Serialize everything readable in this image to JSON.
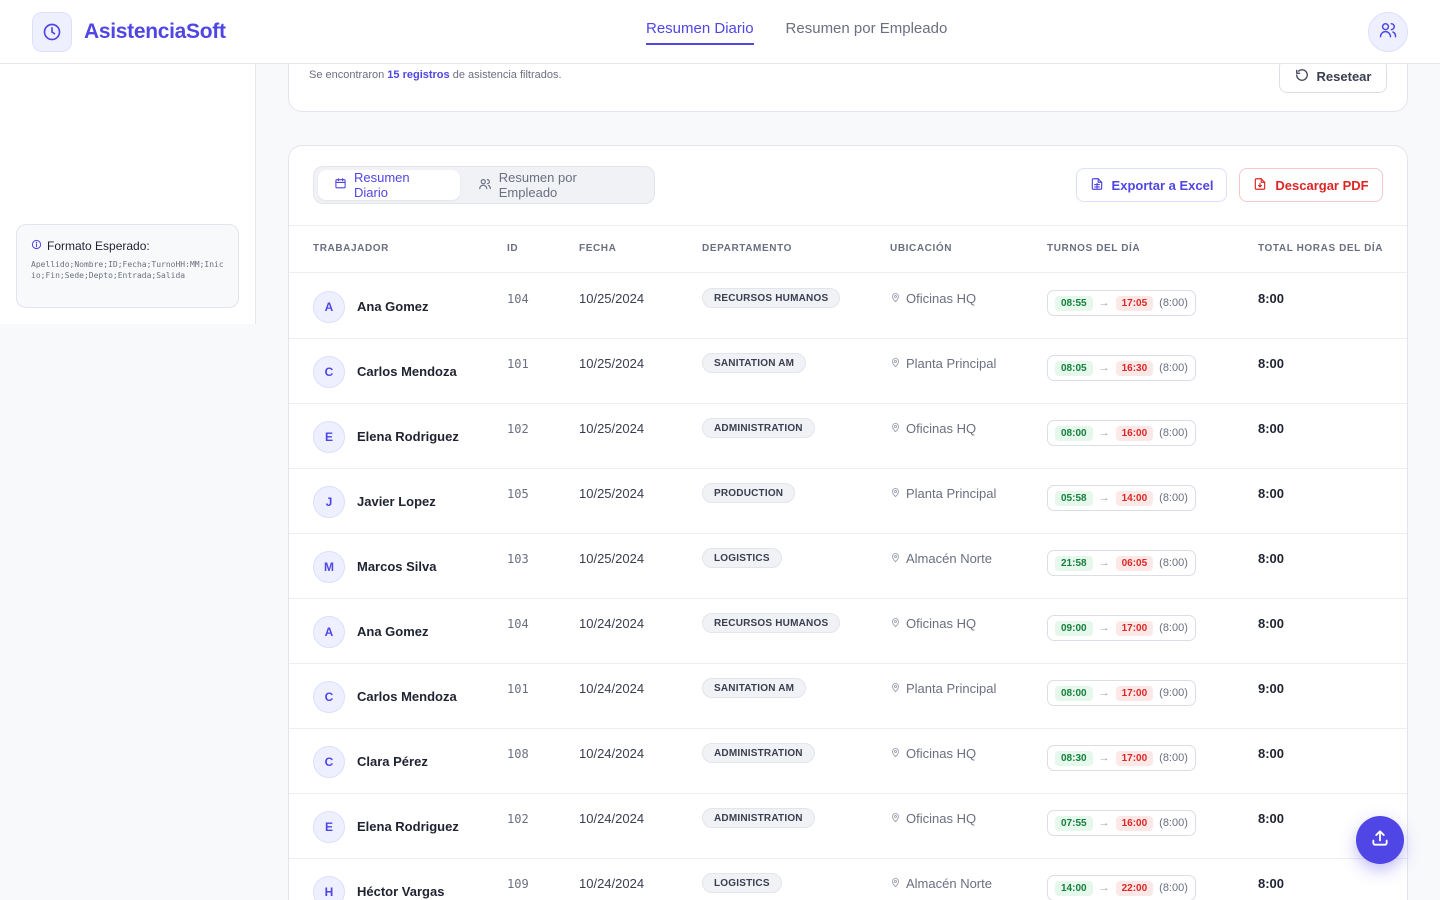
{
  "app": {
    "title": "AsistenciaSoft"
  },
  "nav": {
    "tabs": [
      {
        "label": "Resumen Diario"
      },
      {
        "label": "Resumen por Empleado"
      }
    ]
  },
  "sidebar": {
    "format_title": "Formato Esperado:",
    "format_text": "Apellido;Nombre;ID;Fecha;TurnoHH:MM;Inicio;Fin;Sede;Depto;Entrada;Salida"
  },
  "filter": {
    "info_prefix": "Se encontraron",
    "info_count": "15 registros",
    "info_suffix": "de asistencia filtrados.",
    "reset_label": "Resetear"
  },
  "table_card": {
    "views": [
      {
        "label": "Resumen Diario"
      },
      {
        "label": "Resumen por Empleado"
      }
    ],
    "export_excel_label": "Exportar a Excel",
    "download_pdf_label": "Descargar PDF",
    "columns": [
      "TRABAJADOR",
      "ID",
      "FECHA",
      "DEPARTAMENTO",
      "UBICACIÓN",
      "TURNOS DEL DÍA",
      "TOTAL HORAS DEL DÍA"
    ]
  },
  "rows": [
    {
      "initial": "A",
      "name": "Ana Gomez",
      "id": "104",
      "date": "10/25/2024",
      "dept": "RECURSOS HUMANOS",
      "location": "Oficinas HQ",
      "in": "08:55",
      "out": "17:05",
      "duration": "(8:00)",
      "total": "8:00"
    },
    {
      "initial": "C",
      "name": "Carlos Mendoza",
      "id": "101",
      "date": "10/25/2024",
      "dept": "SANITATION AM",
      "location": "Planta Principal",
      "in": "08:05",
      "out": "16:30",
      "duration": "(8:00)",
      "total": "8:00"
    },
    {
      "initial": "E",
      "name": "Elena Rodriguez",
      "id": "102",
      "date": "10/25/2024",
      "dept": "ADMINISTRATION",
      "location": "Oficinas HQ",
      "in": "08:00",
      "out": "16:00",
      "duration": "(8:00)",
      "total": "8:00"
    },
    {
      "initial": "J",
      "name": "Javier Lopez",
      "id": "105",
      "date": "10/25/2024",
      "dept": "PRODUCTION",
      "location": "Planta Principal",
      "in": "05:58",
      "out": "14:00",
      "duration": "(8:00)",
      "total": "8:00"
    },
    {
      "initial": "M",
      "name": "Marcos Silva",
      "id": "103",
      "date": "10/25/2024",
      "dept": "LOGISTICS",
      "location": "Almacén Norte",
      "in": "21:58",
      "out": "06:05",
      "duration": "(8:00)",
      "total": "8:00"
    },
    {
      "initial": "A",
      "name": "Ana Gomez",
      "id": "104",
      "date": "10/24/2024",
      "dept": "RECURSOS HUMANOS",
      "location": "Oficinas HQ",
      "in": "09:00",
      "out": "17:00",
      "duration": "(8:00)",
      "total": "8:00"
    },
    {
      "initial": "C",
      "name": "Carlos Mendoza",
      "id": "101",
      "date": "10/24/2024",
      "dept": "SANITATION AM",
      "location": "Planta Principal",
      "in": "08:00",
      "out": "17:00",
      "duration": "(9:00)",
      "total": "9:00"
    },
    {
      "initial": "C",
      "name": "Clara Pérez",
      "id": "108",
      "date": "10/24/2024",
      "dept": "ADMINISTRATION",
      "location": "Oficinas HQ",
      "in": "08:30",
      "out": "17:00",
      "duration": "(8:00)",
      "total": "8:00"
    },
    {
      "initial": "E",
      "name": "Elena Rodriguez",
      "id": "102",
      "date": "10/24/2024",
      "dept": "ADMINISTRATION",
      "location": "Oficinas HQ",
      "in": "07:55",
      "out": "16:00",
      "duration": "(8:00)",
      "total": "8:00"
    },
    {
      "initial": "H",
      "name": "Héctor Vargas",
      "id": "109",
      "date": "10/24/2024",
      "dept": "LOGISTICS",
      "location": "Almacén Norte",
      "in": "14:00",
      "out": "22:00",
      "duration": "(8:00)",
      "total": "8:00"
    }
  ],
  "icons": {
    "logo": "clock-icon",
    "user": "users-icon",
    "reset": "rotate-ccw-icon",
    "calendar": "calendar-icon",
    "people": "users-icon",
    "excel": "file-spreadsheet-icon",
    "pdf": "file-download-icon",
    "location": "map-pin-icon",
    "upload": "upload-icon"
  },
  "colors": {
    "accent": "#4f46e5",
    "danger": "#dc2626",
    "success": "#15803d"
  }
}
